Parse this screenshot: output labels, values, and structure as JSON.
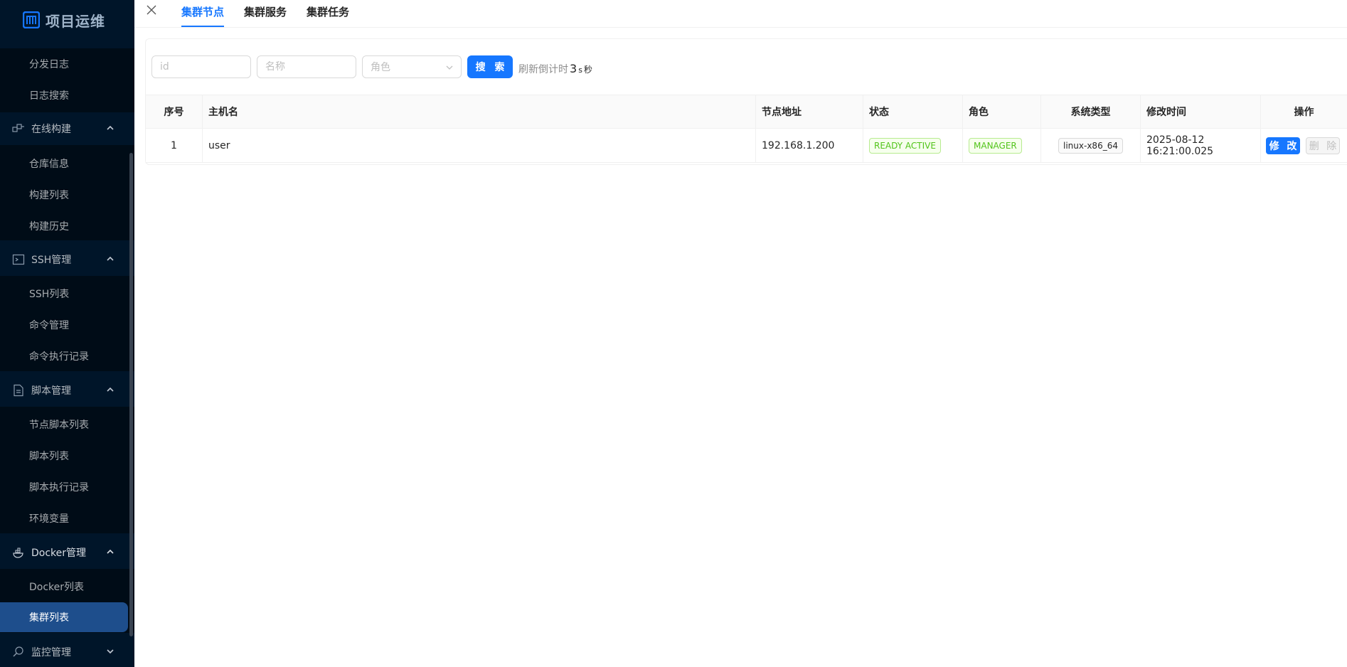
{
  "app": {
    "title": "项目运维"
  },
  "sidebar": {
    "items": [
      {
        "label": "分发日志"
      },
      {
        "label": "日志搜索"
      },
      {
        "label": "在线构建",
        "icon": "build-icon"
      },
      {
        "label": "仓库信息"
      },
      {
        "label": "构建列表"
      },
      {
        "label": "构建历史"
      },
      {
        "label": "SSH管理",
        "icon": "terminal-icon"
      },
      {
        "label": "SSH列表"
      },
      {
        "label": "命令管理"
      },
      {
        "label": "命令执行记录"
      },
      {
        "label": "脚本管理",
        "icon": "file-icon"
      },
      {
        "label": "节点脚本列表"
      },
      {
        "label": "脚本列表"
      },
      {
        "label": "脚本执行记录"
      },
      {
        "label": "环境变量"
      },
      {
        "label": "Docker管理",
        "icon": "docker-icon"
      },
      {
        "label": "Docker列表"
      },
      {
        "label": "集群列表",
        "active": true
      },
      {
        "label": "监控管理",
        "icon": "monitor-icon"
      }
    ]
  },
  "tabs": [
    {
      "label": "集群节点",
      "active": true
    },
    {
      "label": "集群服务"
    },
    {
      "label": "集群任务"
    }
  ],
  "filters": {
    "id_placeholder": "id",
    "name_placeholder": "名称",
    "role_placeholder": "角色",
    "search_label": "搜 索",
    "countdown_prefix": "刷新倒计时",
    "countdown_value": "3",
    "countdown_unit": "s",
    "countdown_suffix": "秒"
  },
  "table": {
    "columns": [
      "序号",
      "主机名",
      "节点地址",
      "状态",
      "角色",
      "系统类型",
      "修改时间",
      "操作"
    ],
    "rows": [
      {
        "index": "1",
        "hostname": "user",
        "address": "192.168.1.200",
        "status": "READY ACTIVE",
        "role": "MANAGER",
        "os_type": "linux-x86_64",
        "modified": "2025-08-12 16:21:00.025",
        "edit_label": "修 改",
        "delete_label": "删 除"
      }
    ]
  },
  "colors": {
    "sidebar_bg": "#001529",
    "active_menu": "#1e4e8c",
    "primary": "#1677ff",
    "success": "#52c41a"
  }
}
